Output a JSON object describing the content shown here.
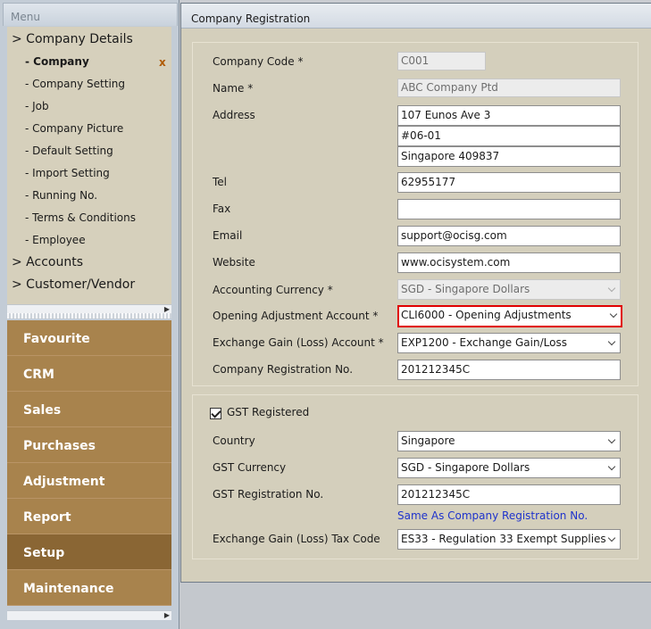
{
  "menu": {
    "title": "Menu",
    "tree": [
      {
        "label": "> Company Details",
        "type": "parent"
      },
      {
        "label": "- Company",
        "type": "child",
        "active": true
      },
      {
        "label": "- Company Setting",
        "type": "child"
      },
      {
        "label": "- Job",
        "type": "child"
      },
      {
        "label": "- Company Picture",
        "type": "child"
      },
      {
        "label": "- Default Setting",
        "type": "child"
      },
      {
        "label": "- Import Setting",
        "type": "child"
      },
      {
        "label": "- Running No.",
        "type": "child"
      },
      {
        "label": "- Terms & Conditions",
        "type": "child"
      },
      {
        "label": "- Employee",
        "type": "child"
      },
      {
        "label": "> Accounts",
        "type": "parent"
      },
      {
        "label": "> Customer/Vendor",
        "type": "parent"
      }
    ],
    "close_mark": "x",
    "modules": [
      "Favourite",
      "CRM",
      "Sales",
      "Purchases",
      "Adjustment",
      "Report",
      "Setup",
      "Maintenance"
    ],
    "active_module": "Setup"
  },
  "window": {
    "title": "Company Registration"
  },
  "form": {
    "company_code": {
      "label": "Company Code *",
      "value": "C001"
    },
    "name": {
      "label": "Name *",
      "value": "ABC Company Ptd"
    },
    "address": {
      "label": "Address",
      "line1": "107 Eunos Ave 3",
      "line2": "#06-01",
      "line3": "Singapore 409837"
    },
    "tel": {
      "label": "Tel",
      "value": "62955177"
    },
    "fax": {
      "label": "Fax",
      "value": ""
    },
    "email": {
      "label": "Email",
      "value": "support@ocisg.com"
    },
    "website": {
      "label": "Website",
      "value": "www.ocisystem.com"
    },
    "accounting_currency": {
      "label": "Accounting Currency *",
      "value": "SGD - Singapore Dollars"
    },
    "opening_adjustment": {
      "label": "Opening Adjustment Account *",
      "value": "CLI6000 - Opening Adjustments"
    },
    "exchange_gain": {
      "label": "Exchange Gain (Loss) Account *",
      "value": "EXP1200 - Exchange Gain/Loss"
    },
    "company_reg": {
      "label": "Company Registration No.",
      "value": "201212345C"
    }
  },
  "gst": {
    "registered_label": "GST Registered",
    "registered": true,
    "country": {
      "label": "Country",
      "value": "Singapore"
    },
    "currency": {
      "label": "GST Currency",
      "value": "SGD - Singapore Dollars"
    },
    "reg_no": {
      "label": "GST Registration No.",
      "value": "201212345C"
    },
    "same_as_link": "Same As Company Registration No.",
    "tax_code": {
      "label": "Exchange Gain (Loss) Tax Code",
      "value": "ES33 - Regulation 33 Exempt Supplies"
    }
  },
  "colors": {
    "accent_highlight": "#e00000",
    "module_bg": "#a8834d",
    "module_active": "#8a6634",
    "link": "#1f33cc"
  }
}
